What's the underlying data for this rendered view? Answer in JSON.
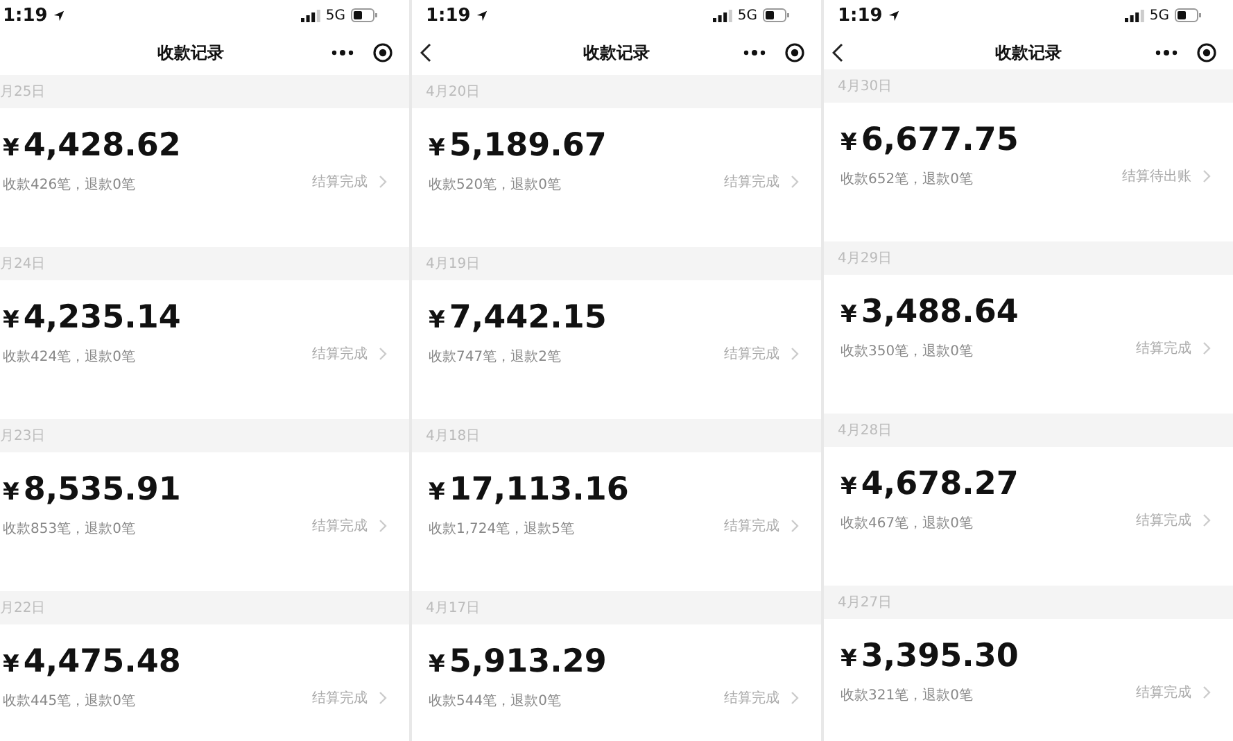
{
  "phones": [
    {
      "time": "1:19",
      "network": "5G",
      "title": "收款记录",
      "back_button": false,
      "records": [
        {
          "date": "月25日",
          "amount": "4,428.62",
          "currency": "¥",
          "summary": "收款426笔，退款0笔",
          "status": "结算完成"
        },
        {
          "date": "月24日",
          "amount": "4,235.14",
          "currency": "¥",
          "summary": "收款424笔，退款0笔",
          "status": "结算完成"
        },
        {
          "date": "月23日",
          "amount": "8,535.91",
          "currency": "¥",
          "summary": "收款853笔，退款0笔",
          "status": "结算完成"
        },
        {
          "date": "月22日",
          "amount": "4,475.48",
          "currency": "¥",
          "summary": "收款445笔，退款0笔",
          "status": "结算完成"
        }
      ]
    },
    {
      "time": "1:19",
      "network": "5G",
      "title": "收款记录",
      "back_button": true,
      "records": [
        {
          "date": "4月20日",
          "amount": "5,189.67",
          "currency": "¥",
          "summary": "收款520笔，退款0笔",
          "status": "结算完成"
        },
        {
          "date": "4月19日",
          "amount": "7,442.15",
          "currency": "¥",
          "summary": "收款747笔，退款2笔",
          "status": "结算完成"
        },
        {
          "date": "4月18日",
          "amount": "17,113.16",
          "currency": "¥",
          "summary": "收款1,724笔，退款5笔",
          "status": "结算完成"
        },
        {
          "date": "4月17日",
          "amount": "5,913.29",
          "currency": "¥",
          "summary": "收款544笔，退款0笔",
          "status": "结算完成"
        }
      ]
    },
    {
      "time": "1:19",
      "network": "5G",
      "title": "收款记录",
      "back_button": true,
      "records": [
        {
          "date": "4月30日",
          "amount": "6,677.75",
          "currency": "¥",
          "summary": "收款652笔，退款0笔",
          "status": "结算待出账"
        },
        {
          "date": "4月29日",
          "amount": "3,488.64",
          "currency": "¥",
          "summary": "收款350笔，退款0笔",
          "status": "结算完成"
        },
        {
          "date": "4月28日",
          "amount": "4,678.27",
          "currency": "¥",
          "summary": "收款467笔，退款0笔",
          "status": "结算完成"
        },
        {
          "date": "4月27日",
          "amount": "3,395.30",
          "currency": "¥",
          "summary": "收款321笔，退款0笔",
          "status": "结算完成"
        }
      ]
    }
  ]
}
